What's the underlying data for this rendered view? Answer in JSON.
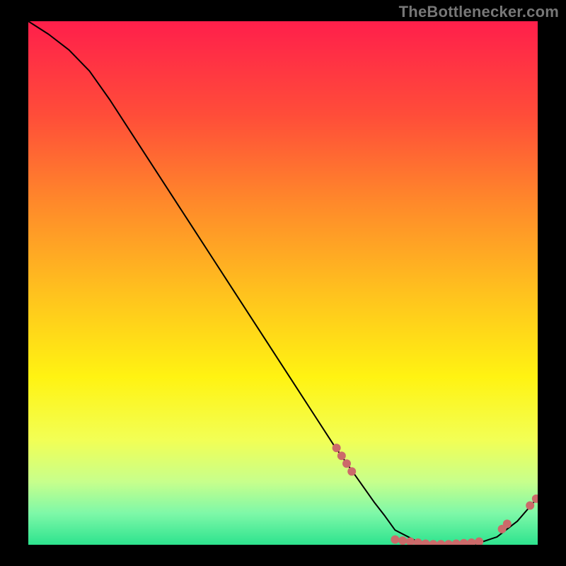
{
  "attribution": "TheBottlenecker.com",
  "chart_data": {
    "type": "line",
    "title": "",
    "xlabel": "",
    "ylabel": "",
    "xlim": [
      0,
      10
    ],
    "ylim": [
      0,
      10
    ],
    "background": {
      "type": "vertical-gradient",
      "stops": [
        {
          "offset": 0.0,
          "color": "#ff1f4b"
        },
        {
          "offset": 0.18,
          "color": "#ff4d39"
        },
        {
          "offset": 0.35,
          "color": "#ff8a2a"
        },
        {
          "offset": 0.52,
          "color": "#ffc21e"
        },
        {
          "offset": 0.68,
          "color": "#fff312"
        },
        {
          "offset": 0.8,
          "color": "#f2ff55"
        },
        {
          "offset": 0.88,
          "color": "#c7ff8c"
        },
        {
          "offset": 0.94,
          "color": "#7ef8a8"
        },
        {
          "offset": 1.0,
          "color": "#2de38e"
        }
      ]
    },
    "series": [
      {
        "name": "bottleneck-curve",
        "color": "#000000",
        "stroke_width": 2,
        "x": [
          0.0,
          0.4,
          0.8,
          1.2,
          1.6,
          2.0,
          2.4,
          2.8,
          3.2,
          3.6,
          4.0,
          4.4,
          4.8,
          5.2,
          5.6,
          6.0,
          6.4,
          6.8,
          7.0,
          7.2,
          7.6,
          8.0,
          8.4,
          8.8,
          9.2,
          9.6,
          10.0
        ],
        "y": [
          10.0,
          9.75,
          9.45,
          9.05,
          8.5,
          7.9,
          7.3,
          6.7,
          6.1,
          5.5,
          4.9,
          4.3,
          3.7,
          3.1,
          2.5,
          1.9,
          1.35,
          0.8,
          0.55,
          0.28,
          0.08,
          0.0,
          0.0,
          0.02,
          0.15,
          0.45,
          0.9
        ]
      }
    ],
    "markers": {
      "name": "data-points",
      "color": "#cc6a6a",
      "radius": 6,
      "points": [
        {
          "x": 6.05,
          "y": 1.85
        },
        {
          "x": 6.15,
          "y": 1.7
        },
        {
          "x": 6.25,
          "y": 1.55
        },
        {
          "x": 6.35,
          "y": 1.4
        },
        {
          "x": 7.2,
          "y": 0.1
        },
        {
          "x": 7.35,
          "y": 0.08
        },
        {
          "x": 7.5,
          "y": 0.06
        },
        {
          "x": 7.65,
          "y": 0.04
        },
        {
          "x": 7.8,
          "y": 0.02
        },
        {
          "x": 7.95,
          "y": 0.01
        },
        {
          "x": 8.1,
          "y": 0.01
        },
        {
          "x": 8.25,
          "y": 0.01
        },
        {
          "x": 8.4,
          "y": 0.02
        },
        {
          "x": 8.55,
          "y": 0.03
        },
        {
          "x": 8.7,
          "y": 0.04
        },
        {
          "x": 8.85,
          "y": 0.06
        },
        {
          "x": 9.3,
          "y": 0.3
        },
        {
          "x": 9.4,
          "y": 0.4
        },
        {
          "x": 9.85,
          "y": 0.75
        },
        {
          "x": 9.97,
          "y": 0.88
        }
      ]
    }
  }
}
